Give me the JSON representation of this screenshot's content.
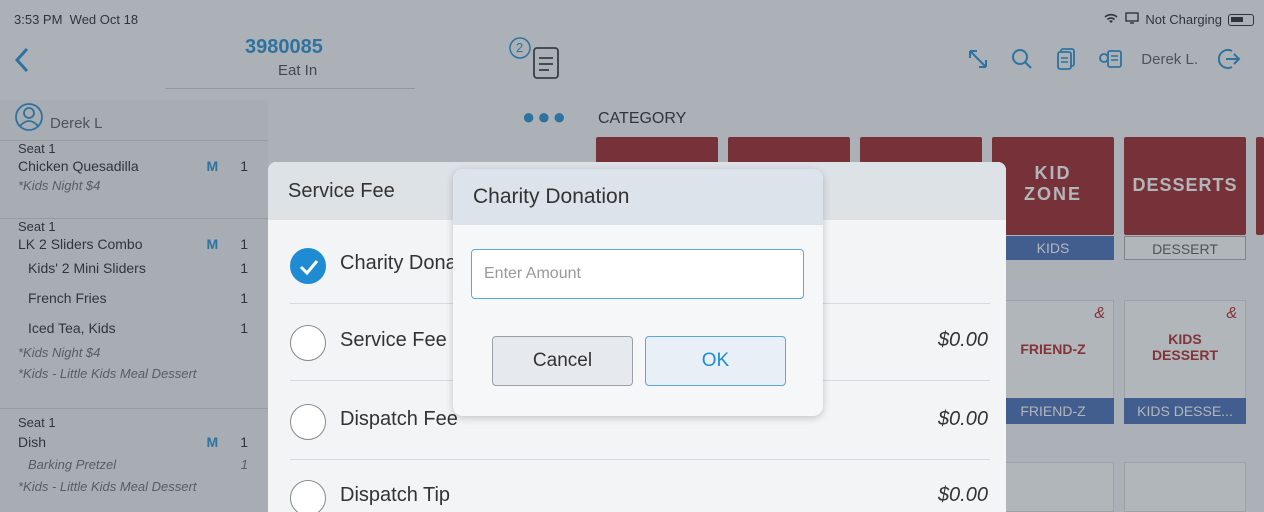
{
  "status_bar": {
    "time": "3:53 PM",
    "date": "Wed Oct 18",
    "charging": "Not Charging"
  },
  "header": {
    "order_number": "3980085",
    "order_type": "Eat In",
    "receipt_count": "2",
    "user": "Derek L."
  },
  "left_panel": {
    "guest": "Derek L",
    "groups": [
      {
        "seat": "Seat 1",
        "item": "Chicken Quesadilla",
        "mod": "M",
        "qty": "1",
        "notes": [
          "*Kids Night $4"
        ],
        "subitems": []
      },
      {
        "seat": "Seat 1",
        "item": "LK 2 Sliders Combo",
        "mod": "M",
        "qty": "1",
        "subitems": [
          {
            "label": "Kids' 2 Mini Sliders",
            "qty": "1"
          },
          {
            "label": "French Fries",
            "qty": "1"
          },
          {
            "label": "Iced Tea, Kids",
            "qty": "1"
          }
        ],
        "notes": [
          "*Kids Night $4",
          "*Kids - Little Kids Meal Dessert"
        ]
      },
      {
        "seat": "Seat 1",
        "item": "Dish",
        "mod": "M",
        "qty": "1",
        "subitems": [
          {
            "label": "Barking Pretzel",
            "qty": "1"
          }
        ],
        "notes": [
          "*Kids - Little Kids Meal Dessert"
        ]
      }
    ]
  },
  "category": {
    "title": "CATEGORY",
    "tiles": [
      {
        "label": "",
        "tag": ""
      },
      {
        "label": "",
        "tag": ""
      },
      {
        "label": "",
        "tag": ""
      },
      {
        "label": "KID ZONE",
        "tag": "KIDS"
      },
      {
        "label": "DESSERTS",
        "tag": "DESSERT"
      }
    ],
    "items": [
      {
        "label": "FRIEND-Z",
        "tag": "FRIEND-Z",
        "symbol": "&"
      },
      {
        "label": "KIDS DESSERT",
        "tag": "KIDS DESSE...",
        "symbol": "&"
      }
    ]
  },
  "service_fee_sheet": {
    "title": "Service Fee",
    "options": [
      {
        "label": "Charity Donation",
        "price": "",
        "checked": true
      },
      {
        "label": "Service Fee",
        "price": "$0.00",
        "checked": false
      },
      {
        "label": "Dispatch Fee",
        "price": "$0.00",
        "checked": false
      },
      {
        "label": "Dispatch Tip",
        "price": "$0.00",
        "checked": false
      }
    ]
  },
  "dialog": {
    "title": "Charity Donation",
    "input_placeholder": "Enter Amount",
    "input_value": "",
    "cancel_label": "Cancel",
    "ok_label": "OK"
  },
  "colors": {
    "accent": "#1e8bd2",
    "category_red": "#9b1a1f",
    "tag_blue": "#3f68b5"
  }
}
